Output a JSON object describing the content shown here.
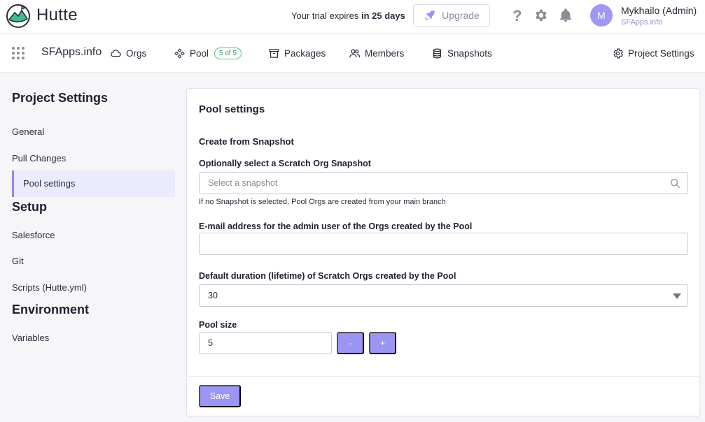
{
  "app": {
    "brand": "Hutte"
  },
  "header": {
    "trial_prefix": "Your trial expires ",
    "trial_bold": "in 25 days",
    "upgrade_label": "Upgrade",
    "help": "?",
    "user": {
      "initial": "M",
      "name": "Mykhailo (Admin)",
      "org": "SFApps.info"
    }
  },
  "nav": {
    "org_name": "SFApps.info",
    "items": [
      {
        "label": "Orgs",
        "icon": "cloud-icon"
      },
      {
        "label": "Pool",
        "icon": "pool-icon",
        "badge": "5 of 5"
      },
      {
        "label": "Packages",
        "icon": "archive-icon"
      },
      {
        "label": "Members",
        "icon": "users-icon"
      },
      {
        "label": "Snapshots",
        "icon": "database-icon"
      },
      {
        "label": "Project Settings",
        "icon": "gear-icon"
      }
    ]
  },
  "sidebar": {
    "groups": [
      {
        "heading": "Project Settings",
        "items": [
          "General",
          "Pull Changes",
          "Pool settings"
        ]
      },
      {
        "heading": "Setup",
        "items": [
          "Salesforce",
          "Git",
          "Scripts (Hutte.yml)"
        ]
      },
      {
        "heading": "Environment",
        "items": [
          "Variables"
        ]
      }
    ],
    "active": "Pool settings"
  },
  "form": {
    "title": "Pool settings",
    "section": "Create from Snapshot",
    "snapshot_label": "Optionally select a Scratch Org Snapshot",
    "snapshot_placeholder": "Select a snapshot",
    "snapshot_hint": "If no Snapshot is selected, Pool Orgs are created from your main branch",
    "email_label": "E-mail address for the admin user of the Orgs created by the Pool",
    "email_value": "",
    "duration_label": "Default duration (lifetime) of Scratch Orgs created by the Pool",
    "duration_value": "30",
    "pool_size_label": "Pool size",
    "pool_size_value": "5",
    "minus": "-",
    "plus": "+",
    "save_label": "Save"
  },
  "colors": {
    "accent": "#9b95f3",
    "active_bg": "#ecebfd",
    "badge_green": "#1f9958"
  }
}
